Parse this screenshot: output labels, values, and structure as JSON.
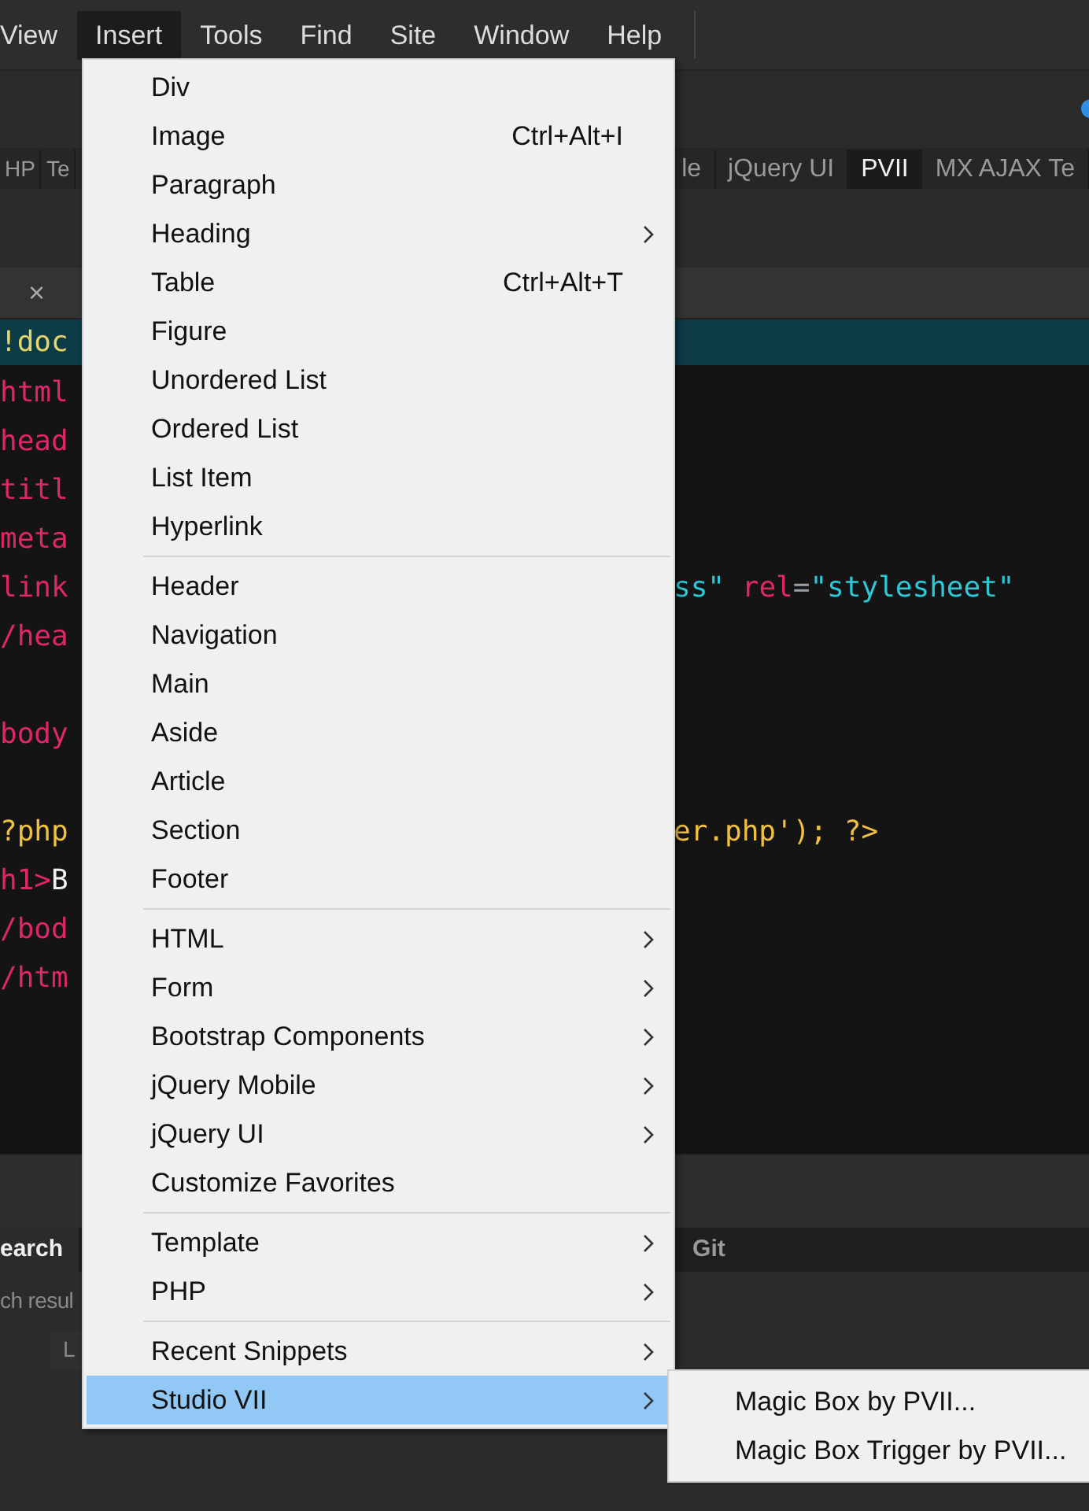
{
  "menubar": [
    {
      "label": "View",
      "selected": false
    },
    {
      "label": "Insert",
      "selected": true
    },
    {
      "label": "Tools",
      "selected": false
    },
    {
      "label": "Find",
      "selected": false
    },
    {
      "label": "Site",
      "selected": false
    },
    {
      "label": "Window",
      "selected": false
    },
    {
      "label": "Help",
      "selected": false
    }
  ],
  "insert_bar": {
    "left_tabs": [
      {
        "label": "HP",
        "selected": false
      },
      {
        "label": "Te",
        "selected": false
      }
    ],
    "right_tabs": [
      {
        "label": "le",
        "selected": false
      },
      {
        "label": "jQuery UI",
        "selected": false
      },
      {
        "label": "PVII",
        "selected": true
      },
      {
        "label": "MX AJAX Te",
        "selected": false
      }
    ]
  },
  "document_tab": {
    "close": "×"
  },
  "code_lines": [
    {
      "highlighted": true,
      "left": [
        {
          "text": "!doc",
          "color": "#e6d56a"
        }
      ]
    },
    {
      "highlighted": false,
      "left": [
        {
          "text": "html",
          "color": "#e0266a"
        }
      ]
    },
    {
      "highlighted": false,
      "left": [
        {
          "text": "head",
          "color": "#e0266a"
        }
      ]
    },
    {
      "highlighted": false,
      "left": [
        {
          "text": "titl",
          "color": "#e0266a"
        }
      ]
    },
    {
      "highlighted": false,
      "left": [
        {
          "text": "meta",
          "color": "#e0266a"
        }
      ]
    },
    {
      "highlighted": false,
      "left": [
        {
          "text": "link",
          "color": "#e0266a"
        }
      ],
      "right": [
        {
          "text": "ss\"",
          "color": "#2ec8d8"
        },
        {
          "text": " rel",
          "color": "#e0266a"
        },
        {
          "text": "=",
          "color": "#9aa0a6"
        },
        {
          "text": "\"stylesheet\"",
          "color": "#2ec8d8"
        }
      ]
    },
    {
      "highlighted": false,
      "left": [
        {
          "text": "/hea",
          "color": "#e0266a"
        }
      ]
    },
    {
      "highlighted": false
    },
    {
      "highlighted": false,
      "left": [
        {
          "text": "body",
          "color": "#e0266a"
        }
      ]
    },
    {
      "highlighted": false
    },
    {
      "highlighted": false,
      "left": [
        {
          "text": "?php",
          "color": "#f0c040"
        }
      ],
      "right": [
        {
          "text": "er.php'); ?>",
          "color": "#f0c040"
        }
      ]
    },
    {
      "highlighted": false,
      "left": [
        {
          "text": "h1>",
          "color": "#e0266a"
        },
        {
          "text": "B",
          "color": "#f0f0f0"
        }
      ]
    },
    {
      "highlighted": false,
      "left": [
        {
          "text": "/bod",
          "color": "#e0266a"
        }
      ]
    },
    {
      "highlighted": false,
      "left": [
        {
          "text": "/htm",
          "color": "#e0266a"
        }
      ]
    }
  ],
  "bottom_tabs": {
    "left": {
      "label": "earch",
      "selected": true
    },
    "right": {
      "label": "Git",
      "selected": false
    }
  },
  "search_results": {
    "text": "ch resul",
    "column_1": "L"
  },
  "insert_menu": {
    "items": [
      {
        "kind": "item",
        "label": "Div",
        "submenu": false,
        "highlighted": false
      },
      {
        "kind": "item",
        "label": "Image",
        "shortcut": "Ctrl+Alt+I",
        "submenu": false,
        "highlighted": false
      },
      {
        "kind": "item",
        "label": "Paragraph",
        "submenu": false,
        "highlighted": false
      },
      {
        "kind": "item",
        "label": "Heading",
        "submenu": true,
        "highlighted": false
      },
      {
        "kind": "item",
        "label": "Table",
        "shortcut": "Ctrl+Alt+T",
        "submenu": false,
        "highlighted": false
      },
      {
        "kind": "item",
        "label": "Figure",
        "submenu": false,
        "highlighted": false
      },
      {
        "kind": "item",
        "label": "Unordered List",
        "submenu": false,
        "highlighted": false
      },
      {
        "kind": "item",
        "label": "Ordered List",
        "submenu": false,
        "highlighted": false
      },
      {
        "kind": "item",
        "label": "List Item",
        "submenu": false,
        "highlighted": false
      },
      {
        "kind": "item",
        "label": "Hyperlink",
        "submenu": false,
        "highlighted": false
      },
      {
        "kind": "separator"
      },
      {
        "kind": "item",
        "label": "Header",
        "submenu": false,
        "highlighted": false
      },
      {
        "kind": "item",
        "label": "Navigation",
        "submenu": false,
        "highlighted": false
      },
      {
        "kind": "item",
        "label": "Main",
        "submenu": false,
        "highlighted": false
      },
      {
        "kind": "item",
        "label": "Aside",
        "submenu": false,
        "highlighted": false
      },
      {
        "kind": "item",
        "label": "Article",
        "submenu": false,
        "highlighted": false
      },
      {
        "kind": "item",
        "label": "Section",
        "submenu": false,
        "highlighted": false
      },
      {
        "kind": "item",
        "label": "Footer",
        "submenu": false,
        "highlighted": false
      },
      {
        "kind": "separator"
      },
      {
        "kind": "item",
        "label": "HTML",
        "submenu": true,
        "highlighted": false
      },
      {
        "kind": "item",
        "label": "Form",
        "submenu": true,
        "highlighted": false
      },
      {
        "kind": "item",
        "label": "Bootstrap Components",
        "submenu": true,
        "highlighted": false
      },
      {
        "kind": "item",
        "label": "jQuery Mobile",
        "submenu": true,
        "highlighted": false
      },
      {
        "kind": "item",
        "label": "jQuery UI",
        "submenu": true,
        "highlighted": false
      },
      {
        "kind": "item",
        "label": "Customize Favorites",
        "submenu": false,
        "highlighted": false
      },
      {
        "kind": "separator"
      },
      {
        "kind": "item",
        "label": "Template",
        "submenu": true,
        "highlighted": false
      },
      {
        "kind": "item",
        "label": "PHP",
        "submenu": true,
        "highlighted": false
      },
      {
        "kind": "separator"
      },
      {
        "kind": "item",
        "label": "Recent Snippets",
        "submenu": true,
        "highlighted": false
      },
      {
        "kind": "item",
        "label": "Studio VII",
        "submenu": true,
        "highlighted": true
      }
    ]
  },
  "studio_submenu": {
    "items": [
      {
        "label": "Magic Box by PVII...",
        "highlighted": false
      },
      {
        "label": "Magic Box Trigger by PVII...",
        "highlighted": false
      }
    ]
  }
}
